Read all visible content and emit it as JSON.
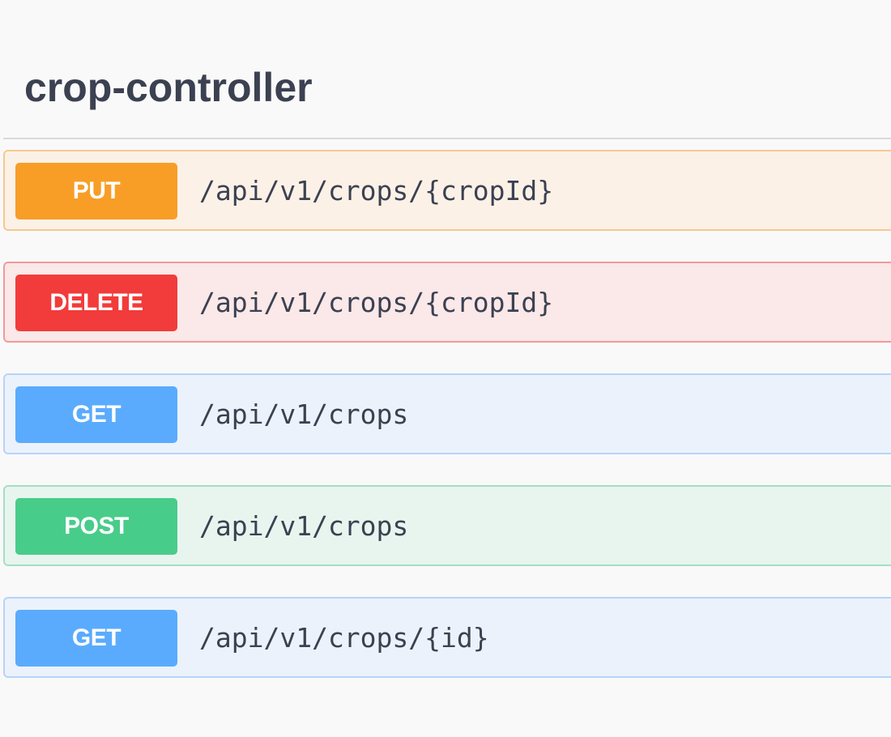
{
  "section": {
    "title": "crop-controller"
  },
  "operations": [
    {
      "method": "PUT",
      "path": "/api/v1/crops/{cropId}",
      "color": "#f89e27"
    },
    {
      "method": "DELETE",
      "path": "/api/v1/crops/{cropId}",
      "color": "#f23b3b"
    },
    {
      "method": "GET",
      "path": "/api/v1/crops",
      "color": "#5aabfd"
    },
    {
      "method": "POST",
      "path": "/api/v1/crops",
      "color": "#48cc8a"
    },
    {
      "method": "GET",
      "path": "/api/v1/crops/{id}",
      "color": "#5aabfd"
    }
  ]
}
